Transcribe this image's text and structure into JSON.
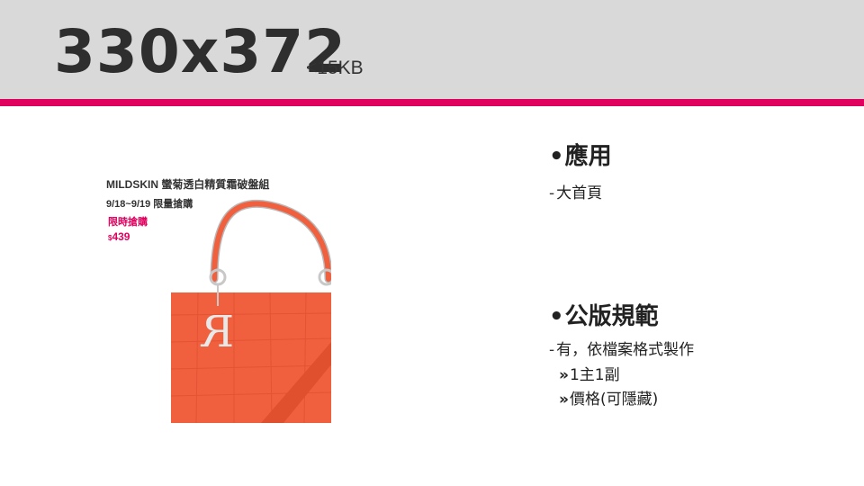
{
  "header": {
    "size_title": "330x372",
    "size_note": "<15KB",
    "background_color": "#d9d9d9",
    "accent_color": "#e0005e"
  },
  "banner": {
    "line1": "MILDSKIN 蠻菊透白精質霜破盤組",
    "line2": "9/18~9/19  限量搶購",
    "line3": "限時搶購",
    "price_currency": "$",
    "price_value": "439",
    "bag_color": "#f0603e"
  },
  "info": {
    "application": {
      "bullet": "•",
      "heading": "應用",
      "dash": "-",
      "item": "大首頁"
    },
    "spec": {
      "bullet": "•",
      "heading": "公版規範",
      "dash": "-",
      "item1": "有，依檔案格式製作",
      "chevron": "»",
      "item2": "1主1副",
      "item3": "價格(可隱藏)"
    }
  }
}
